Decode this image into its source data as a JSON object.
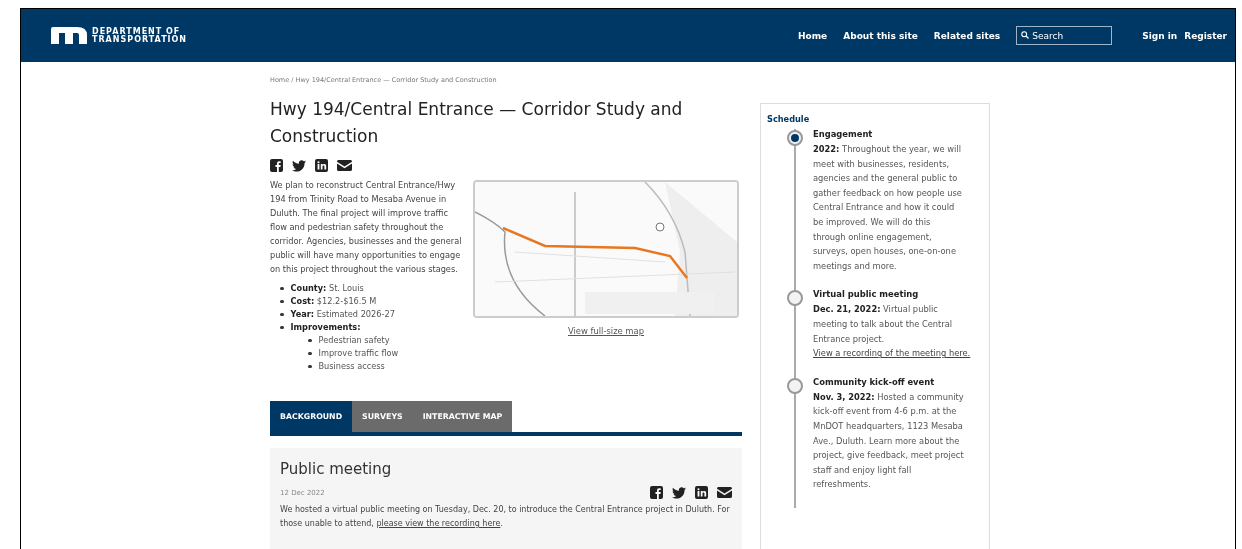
{
  "header": {
    "agency_line_1": "DEPARTMENT OF",
    "agency_line_2": "TRANSPORTATION",
    "nav": [
      "Home",
      "About this site",
      "Related sites"
    ],
    "search": {
      "placeholder": "Search"
    },
    "account": [
      "Sign in",
      "Register"
    ]
  },
  "breadcrumb": {
    "separator": "/",
    "items": [
      "Home",
      "Hwy 194/Central Entrance — Corridor Study and Construction"
    ]
  },
  "title": "Hwy 194/Central Entrance — Corridor Study and Construction",
  "intro": "We plan to reconstruct Central Entrance/Hwy 194 from Trinity Road to Mesaba Avenue in Duluth. The final project will improve traffic flow and pedestrian safety throughout the corridor. Agencies, businesses and the general public will have many opportunities to engage on this project throughout the various stages.",
  "map": {
    "link": "View full-size map"
  },
  "facts": [
    {
      "label": "County:",
      "value": "St. Louis"
    },
    {
      "label": "Cost:",
      "value": "$12.2-$16.5 M"
    },
    {
      "label": "Year:",
      "value": "Estimated 2026-27"
    },
    {
      "label": "Improvements:",
      "children": [
        "Pedestrian safety",
        "Improve traffic flow",
        "Business access"
      ]
    }
  ],
  "tabs": [
    {
      "label": "BACKGROUND",
      "selected": true
    },
    {
      "label": "SURVEYS",
      "selected": false
    },
    {
      "label": "INTERACTIVE MAP",
      "selected": false
    }
  ],
  "article": {
    "title": "Public meeting",
    "date": "12 Dec 2022",
    "text": "We hosted a virtual public meeting on Tuesday, Dec. 20, to introduce the Central Entrance project in Duluth. For those unable to attend,",
    "link": "please view the recording here",
    "after": "."
  },
  "schedule": {
    "title": "Schedule",
    "events": [
      {
        "title": "Engagement",
        "current": true,
        "text": "**2022:** Throughout the year, we will meet with businesses, residents, agencies and the general public to gather feedback on how people use Central Entrance and how it could be improved. We will do this through online engagement, surveys, open houses, one-on-one meetings and more."
      },
      {
        "title": "Virtual public meeting",
        "current": false,
        "text": "**Dec. 21, 2022:** Virtual public meeting to talk about the Central Entrance project.",
        "link": "View a recording of the meeting here."
      },
      {
        "title": "Community kick-off event",
        "current": false,
        "text": "**Nov. 3, 2022:** Hosted a community kick-off event from 4-6 p.m. at the MnDOT headquarters, 1123 Mesaba Ave., Duluth. Learn more about the project, give feedback, meet project staff and enjoy light fall refreshments."
      }
    ]
  }
}
